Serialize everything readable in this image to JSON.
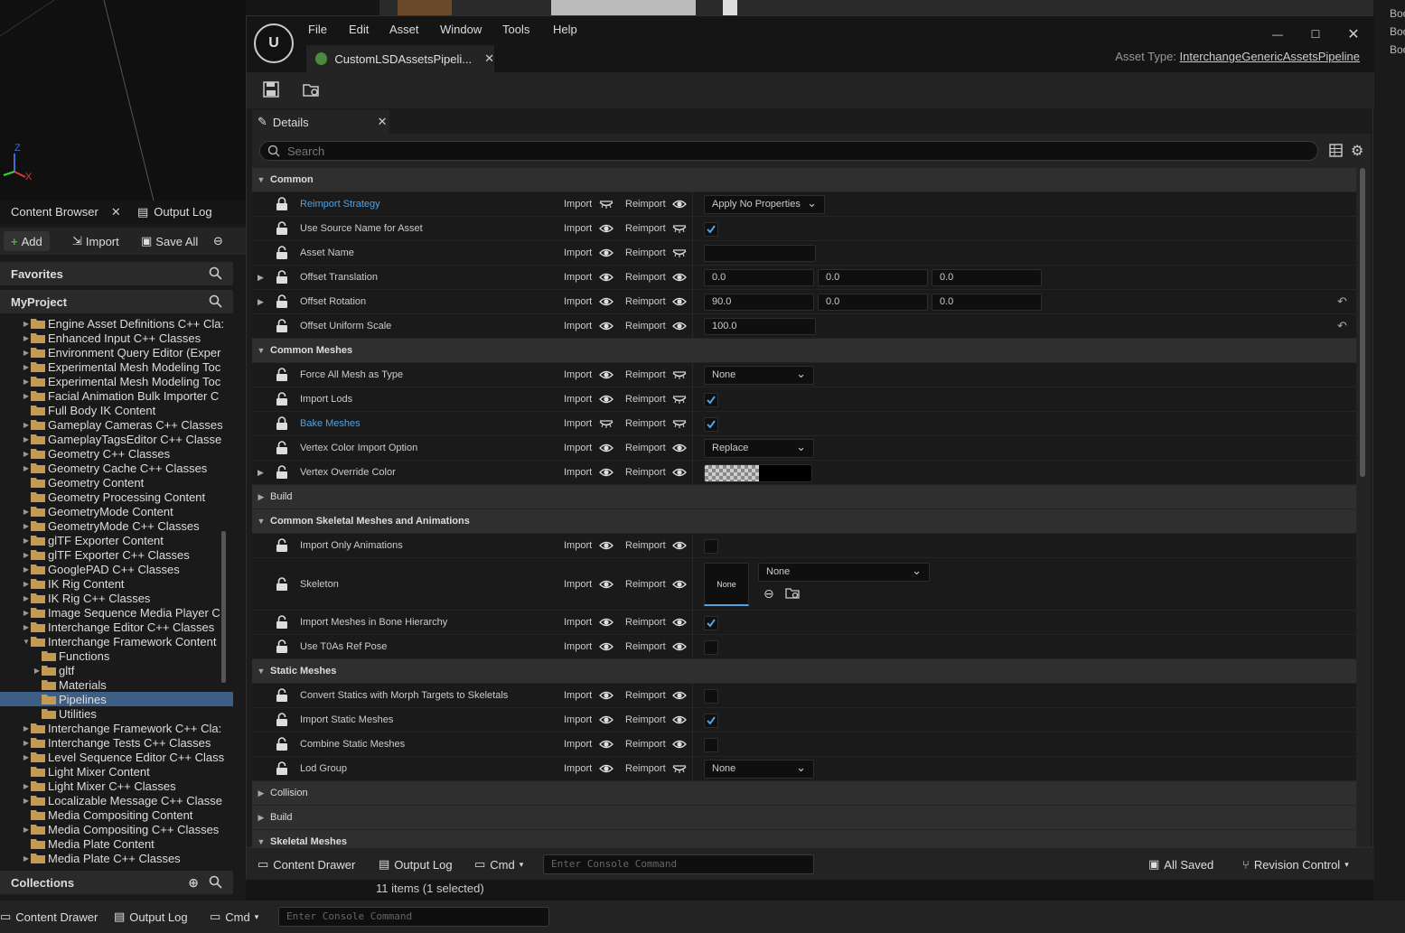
{
  "background": {
    "axis_labels": [
      "Z",
      "X"
    ],
    "outliner_items": [
      "Boo",
      "Boo",
      "Boo"
    ],
    "content_browser_tab": "Content Browser",
    "output_log_tab": "Output Log",
    "toolbar": {
      "add": "Add",
      "import": "Import",
      "save_all": "Save All"
    },
    "favorites": "Favorites",
    "project": "MyProject",
    "collections": "Collections",
    "tree_items": [
      {
        "label": "Engine Asset Definitions C++ Cla:",
        "indent": 0,
        "expand": true
      },
      {
        "label": "Enhanced Input C++ Classes",
        "indent": 0,
        "expand": true
      },
      {
        "label": "Environment Query Editor (Exper",
        "indent": 0,
        "expand": true
      },
      {
        "label": "Experimental Mesh Modeling Toc",
        "indent": 0,
        "expand": true
      },
      {
        "label": "Experimental Mesh Modeling Toc",
        "indent": 0,
        "expand": true
      },
      {
        "label": "Facial Animation Bulk Importer C",
        "indent": 0,
        "expand": true
      },
      {
        "label": "Full Body IK Content",
        "indent": 0,
        "expand": false
      },
      {
        "label": "Gameplay Cameras C++ Classes",
        "indent": 0,
        "expand": true
      },
      {
        "label": "GameplayTagsEditor C++ Classe",
        "indent": 0,
        "expand": true
      },
      {
        "label": "Geometry C++ Classes",
        "indent": 0,
        "expand": true
      },
      {
        "label": "Geometry Cache C++ Classes",
        "indent": 0,
        "expand": true
      },
      {
        "label": "Geometry Content",
        "indent": 0,
        "expand": false
      },
      {
        "label": "Geometry Processing Content",
        "indent": 0,
        "expand": false
      },
      {
        "label": "GeometryMode Content",
        "indent": 0,
        "expand": true
      },
      {
        "label": "GeometryMode C++ Classes",
        "indent": 0,
        "expand": true
      },
      {
        "label": "glTF Exporter Content",
        "indent": 0,
        "expand": true
      },
      {
        "label": "glTF Exporter C++ Classes",
        "indent": 0,
        "expand": true
      },
      {
        "label": "GooglePAD C++ Classes",
        "indent": 0,
        "expand": true
      },
      {
        "label": "IK Rig Content",
        "indent": 0,
        "expand": true
      },
      {
        "label": "IK Rig C++ Classes",
        "indent": 0,
        "expand": true
      },
      {
        "label": "Image Sequence Media Player C",
        "indent": 0,
        "expand": true
      },
      {
        "label": "Interchange Editor C++ Classes",
        "indent": 0,
        "expand": true
      },
      {
        "label": "Interchange Framework Content",
        "indent": 0,
        "expand": true,
        "open": true
      },
      {
        "label": "Functions",
        "indent": 1,
        "expand": false
      },
      {
        "label": "gltf",
        "indent": 1,
        "expand": true
      },
      {
        "label": "Materials",
        "indent": 1,
        "expand": false
      },
      {
        "label": "Pipelines",
        "indent": 1,
        "expand": false,
        "selected": true
      },
      {
        "label": "Utilities",
        "indent": 1,
        "expand": false
      },
      {
        "label": "Interchange Framework C++ Cla:",
        "indent": 0,
        "expand": true
      },
      {
        "label": "Interchange Tests C++ Classes",
        "indent": 0,
        "expand": true
      },
      {
        "label": "Level Sequence Editor C++ Class",
        "indent": 0,
        "expand": true
      },
      {
        "label": "Light Mixer Content",
        "indent": 0,
        "expand": false
      },
      {
        "label": "Light Mixer C++ Classes",
        "indent": 0,
        "expand": true
      },
      {
        "label": "Localizable Message C++ Classe",
        "indent": 0,
        "expand": true
      },
      {
        "label": "Media Compositing Content",
        "indent": 0,
        "expand": false
      },
      {
        "label": "Media Compositing C++ Classes",
        "indent": 0,
        "expand": true
      },
      {
        "label": "Media Plate Content",
        "indent": 0,
        "expand": false
      },
      {
        "label": "Media Plate C++ Classes",
        "indent": 0,
        "expand": true
      }
    ],
    "status": "11 items (1 selected)",
    "bottom": {
      "drawer": "Content Drawer",
      "log": "Output Log",
      "cmd": "Cmd",
      "console_placeholder": "Enter Console Command"
    }
  },
  "editor": {
    "menus": [
      "File",
      "Edit",
      "Asset",
      "Window",
      "Tools",
      "Help"
    ],
    "asset_tab": "CustomLSDAssetsPipeli...",
    "asset_type_label": "Asset Type:",
    "asset_type_value": "InterchangeGenericAssetsPipeline",
    "details_tab": "Details",
    "search_placeholder": "Search",
    "import_label": "Import",
    "reimport_label": "Reimport",
    "rows": [
      {
        "type": "cat",
        "label": "Common",
        "open": true
      },
      {
        "type": "prop",
        "label": "Reimport Strategy",
        "blue": true,
        "locked": true,
        "eye1": false,
        "eye2": true,
        "value": {
          "kind": "combo",
          "text": "Apply No Properties",
          "w": 134
        }
      },
      {
        "type": "prop",
        "label": "Use Source Name for Asset",
        "eye1": true,
        "eye2": false,
        "value": {
          "kind": "check",
          "checked": true
        }
      },
      {
        "type": "prop",
        "label": "Asset Name",
        "eye1": true,
        "eye2": false,
        "value": {
          "kind": "text",
          "text": ""
        }
      },
      {
        "type": "prop",
        "label": "Offset Translation",
        "expandable": true,
        "eye1": true,
        "eye2": true,
        "value": {
          "kind": "vec",
          "vals": [
            "0.0",
            "0.0",
            "0.0"
          ]
        }
      },
      {
        "type": "prop",
        "label": "Offset Rotation",
        "expandable": true,
        "eye1": true,
        "eye2": true,
        "value": {
          "kind": "vec",
          "vals": [
            "90.0",
            "0.0",
            "0.0"
          ]
        },
        "reset": true
      },
      {
        "type": "prop",
        "label": "Offset Uniform Scale",
        "eye1": true,
        "eye2": true,
        "value": {
          "kind": "text",
          "text": "100.0"
        },
        "reset": true
      },
      {
        "type": "cat",
        "label": "Common Meshes",
        "open": true
      },
      {
        "type": "prop",
        "label": "Force All Mesh as Type",
        "eye1": true,
        "eye2": false,
        "value": {
          "kind": "combo",
          "text": "None",
          "w": 122
        }
      },
      {
        "type": "prop",
        "label": "Import Lods",
        "eye1": true,
        "eye2": false,
        "value": {
          "kind": "check",
          "checked": true
        }
      },
      {
        "type": "prop",
        "label": "Bake Meshes",
        "blue": true,
        "locked": true,
        "eye1": false,
        "eye2": false,
        "value": {
          "kind": "check",
          "checked": true
        }
      },
      {
        "type": "prop",
        "label": "Vertex Color Import Option",
        "eye1": true,
        "eye2": true,
        "value": {
          "kind": "combo",
          "text": "Replace",
          "w": 122
        }
      },
      {
        "type": "prop",
        "label": "Vertex Override Color",
        "expandable": true,
        "eye1": true,
        "eye2": true,
        "value": {
          "kind": "color"
        }
      },
      {
        "type": "cat",
        "label": "Build",
        "open": false,
        "sub": true
      },
      {
        "type": "cat",
        "label": "Common Skeletal Meshes and Animations",
        "open": true
      },
      {
        "type": "prop",
        "label": "Import Only Animations",
        "eye1": true,
        "eye2": true,
        "value": {
          "kind": "check",
          "checked": false
        }
      },
      {
        "type": "prop",
        "label": "Skeleton",
        "eye1": true,
        "eye2": true,
        "tall": true,
        "value": {
          "kind": "asset",
          "thumb": "None",
          "text": "None"
        }
      },
      {
        "type": "prop",
        "label": "Import Meshes in Bone Hierarchy",
        "eye1": true,
        "eye2": true,
        "value": {
          "kind": "check",
          "checked": true
        }
      },
      {
        "type": "prop",
        "label": "Use T0As Ref Pose",
        "eye1": true,
        "eye2": true,
        "value": {
          "kind": "check",
          "checked": false
        }
      },
      {
        "type": "cat",
        "label": "Static Meshes",
        "open": true
      },
      {
        "type": "prop",
        "label": "Convert Statics with Morph Targets to Skeletals",
        "eye1": true,
        "eye2": true,
        "value": {
          "kind": "check",
          "checked": false
        }
      },
      {
        "type": "prop",
        "label": "Import Static Meshes",
        "eye1": true,
        "eye2": true,
        "value": {
          "kind": "check",
          "checked": true
        }
      },
      {
        "type": "prop",
        "label": "Combine Static Meshes",
        "eye1": true,
        "eye2": true,
        "value": {
          "kind": "check",
          "checked": false
        }
      },
      {
        "type": "prop",
        "label": "Lod Group",
        "eye1": true,
        "eye2": false,
        "value": {
          "kind": "combo",
          "text": "None",
          "w": 122
        }
      },
      {
        "type": "cat",
        "label": "Collision",
        "open": false,
        "sub": true
      },
      {
        "type": "cat",
        "label": "Build",
        "open": false,
        "sub": true
      },
      {
        "type": "cat",
        "label": "Skeletal Meshes",
        "open": true
      }
    ],
    "bottom": {
      "drawer": "Content Drawer",
      "log": "Output Log",
      "cmd": "Cmd",
      "console_placeholder": "Enter Console Command",
      "saved": "All Saved",
      "revision": "Revision Control"
    }
  },
  "colors": {
    "accent_blue": "#4fa3e6",
    "selection": "#3d5f86",
    "folder": "#c49a50"
  }
}
